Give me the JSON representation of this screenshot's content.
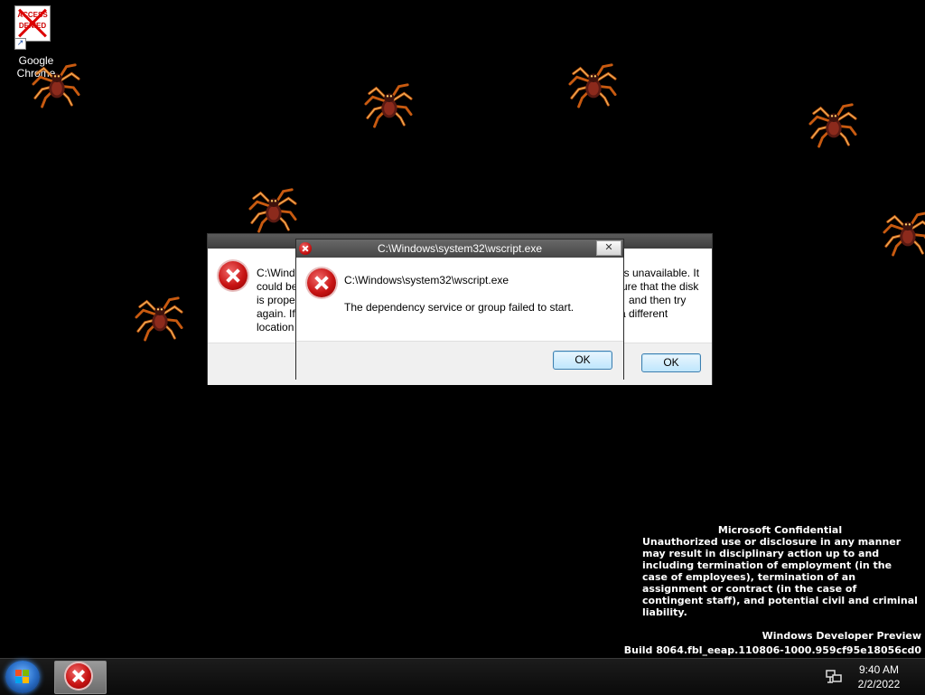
{
  "desktop": {
    "icon_overlay_text": "ACCESS DENIED",
    "icon_label": "Google Chrome"
  },
  "dialog_back": {
    "text_left": [
      "C:\\Windo",
      "could be",
      "is prope",
      "again. If",
      "location"
    ],
    "text_right": [
      "is unavailable. It",
      "ure that the disk",
      "and then try",
      "a different",
      ""
    ],
    "ok_label": "OK"
  },
  "dialog_front": {
    "title": "C:\\Windows\\system32\\wscript.exe",
    "close_glyph": "✕",
    "heading": "C:\\Windows\\system32\\wscript.exe",
    "message": "The dependency service or group failed to start.",
    "ok_label": "OK"
  },
  "watermark": {
    "heading": "Microsoft Confidential",
    "body": "Unauthorized use or disclosure in any manner may result in disciplinary action up to and including termination of employment (in the case of employees), termination of an assignment or contract (in the case of contingent staff), and potential civil and criminal liability.",
    "edition": "Windows Developer Preview",
    "build": "Build 8064.fbl_eeap.110806-1000.959cf95e18056cd0"
  },
  "taskbar": {
    "time": "9:40 AM",
    "date": "2/2/2022",
    "tray_icon": "network-icon"
  },
  "colors": {
    "error_red": "#c81414",
    "button_blue": "#3c7fb1"
  }
}
